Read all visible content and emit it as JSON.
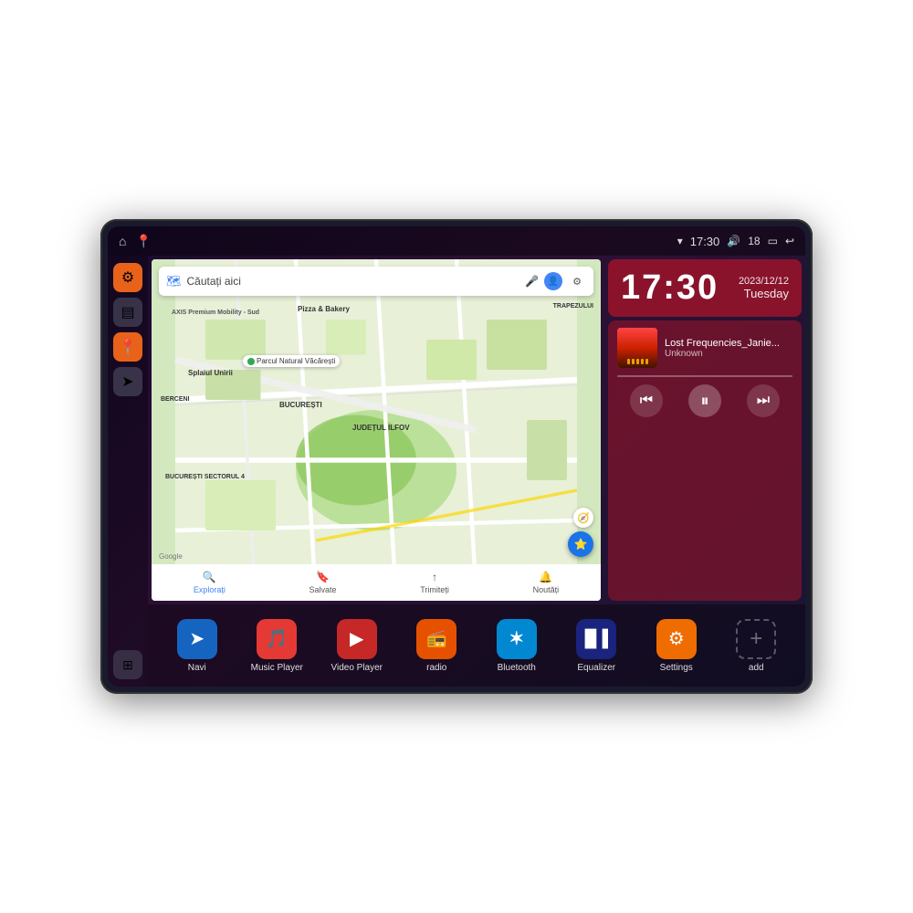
{
  "device": {
    "status_bar": {
      "left_icons": [
        "home",
        "location"
      ],
      "wifi_icon": "▾",
      "time": "17:30",
      "volume_icon": "🔊",
      "battery_level": "18",
      "battery_icon": "▭",
      "back_icon": "↩"
    }
  },
  "sidebar": {
    "settings_label": "⚙",
    "files_label": "▤",
    "maps_label": "📍",
    "navigation_label": "➤",
    "grid_label": "⊞"
  },
  "map": {
    "search_placeholder": "Căutați aici",
    "location_label": "Parcul Natural Văcărești",
    "axis_label": "AXIS Premium Mobility - Sud",
    "pizza_label": "Pizza & Bakery",
    "trapezul_label": "TRAPEZULUI",
    "berceni_label": "BERCENI",
    "bucuresti_label": "BUCUREȘTI",
    "sectorul4_label": "BUCUREȘTI SECTORUL 4",
    "judetul_label": "JUDEȚUL ILFOV",
    "splaiul_label": "Splaiul Unirii",
    "nav_items": [
      {
        "icon": "🔍",
        "label": "Explorați",
        "active": true
      },
      {
        "icon": "🔖",
        "label": "Salvate",
        "active": false
      },
      {
        "icon": "⬆",
        "label": "Trimiteți",
        "active": false
      },
      {
        "icon": "🔔",
        "label": "Noutăți",
        "active": false
      }
    ]
  },
  "clock": {
    "time": "17:30",
    "date": "2023/12/12",
    "weekday": "Tuesday"
  },
  "music": {
    "title": "Lost Frequencies_Janie...",
    "artist": "Unknown",
    "controls": {
      "prev": "⏮",
      "play": "⏸",
      "next": "⏭"
    }
  },
  "apps": [
    {
      "id": "navi",
      "icon": "➤",
      "label": "Navi",
      "color": "blue"
    },
    {
      "id": "music-player",
      "icon": "🎵",
      "label": "Music Player",
      "color": "red"
    },
    {
      "id": "video-player",
      "icon": "▶",
      "label": "Video Player",
      "color": "purple-red"
    },
    {
      "id": "radio",
      "icon": "📻",
      "label": "radio",
      "color": "orange"
    },
    {
      "id": "bluetooth",
      "icon": "✶",
      "label": "Bluetooth",
      "color": "blue-light"
    },
    {
      "id": "equalizer",
      "icon": "≡",
      "label": "Equalizer",
      "color": "dark-blue"
    },
    {
      "id": "settings",
      "icon": "⚙",
      "label": "Settings",
      "color": "orange2"
    },
    {
      "id": "add",
      "icon": "+",
      "label": "add",
      "color": "outlined"
    }
  ]
}
